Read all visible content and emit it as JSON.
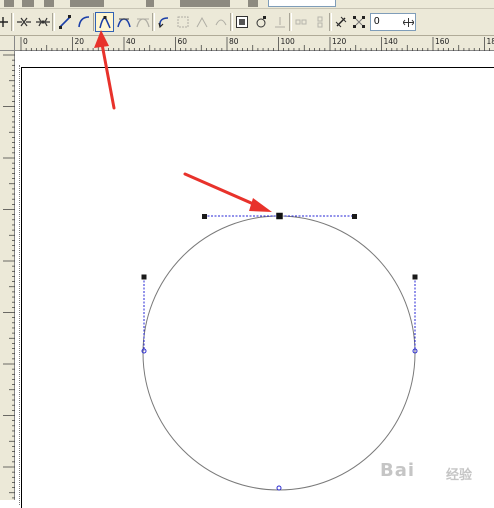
{
  "toolbar": {
    "angle_value": "0",
    "tools": [
      {
        "icon": "add-node-icon"
      },
      {
        "icon": "delete-node-icon"
      },
      {
        "icon": "join-nodes-icon"
      },
      {
        "icon": "break-curve-icon"
      },
      {
        "icon": "to-line-icon"
      },
      {
        "icon": "to-curve-icon"
      },
      {
        "icon": "cusp-node-icon"
      },
      {
        "icon": "smooth-node-icon"
      },
      {
        "icon": "symmetrical-node-icon"
      },
      {
        "icon": "reverse-direction-icon"
      },
      {
        "icon": "extend-curve-icon"
      },
      {
        "icon": "extract-subpath-icon"
      },
      {
        "icon": "auto-close-icon"
      },
      {
        "icon": "stretch-scale-icon"
      },
      {
        "icon": "rotate-skew-icon"
      },
      {
        "icon": "align-nodes-icon"
      },
      {
        "icon": "elastic-mode-icon"
      },
      {
        "icon": "reduce-nodes-icon"
      },
      {
        "icon": "select-all-nodes-icon"
      }
    ]
  },
  "ruler": {
    "unit_labels": [
      "0",
      "20",
      "40",
      "60",
      "80",
      "100",
      "120",
      "140",
      "160",
      "180"
    ]
  },
  "watermark": {
    "text": "Bai",
    "sub": "经验"
  },
  "colors": {
    "toolbar_bg": "#ece9d8",
    "annotation_arrow": "#e8322b",
    "control_line": "#2424d6",
    "node_fill": "#1a1a1a",
    "circle_stroke": "#777777"
  }
}
